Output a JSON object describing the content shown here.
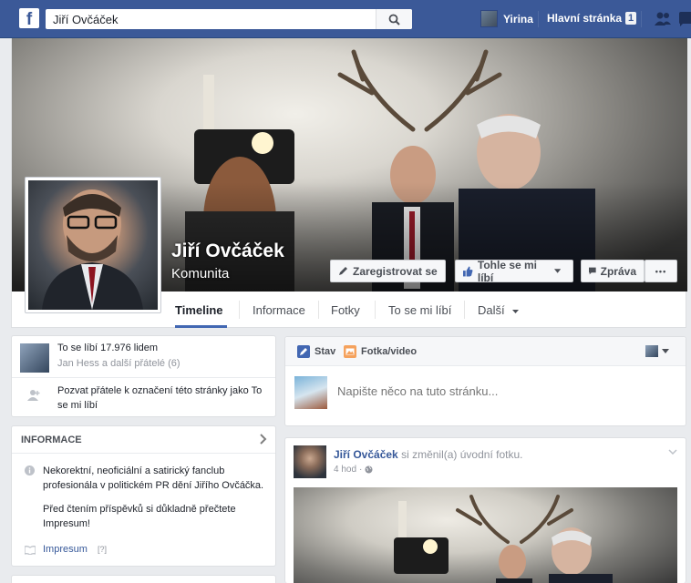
{
  "topbar": {
    "search_value": "Jiří Ovčáček",
    "user_name": "Yirina",
    "home_label": "Hlavní stránka",
    "home_count": "1",
    "brand_color": "#3b5998"
  },
  "page": {
    "name": "Jiří Ovčáček",
    "category": "Komunita",
    "buttons": {
      "register": "Zaregistrovat se",
      "like": "Tohle se mi líbí",
      "message": "Zpráva",
      "more": "•••"
    },
    "tabs": [
      "Timeline",
      "Informace",
      "Fotky",
      "To se mi líbí",
      "Další"
    ]
  },
  "likes_card": {
    "count_text": "To se líbí 17.976 lidem",
    "friends_text": "Jan Hess a další přátelé (6)",
    "invite_text": "Pozvat přátele k označení této stránky jako To se mi líbí"
  },
  "info_card": {
    "title": "INFORMACE",
    "description": "Nekorektní, neoficiální a satirický fanclub profesionála v politickém PR dění Jiřího Ovčáčka.",
    "note": "Před čtením příspěvků si důkladně přečtete Impresum!",
    "link_label": "Impresum",
    "link_hint": "[?]"
  },
  "composer": {
    "tab_status": "Stav",
    "tab_photo": "Fotka/video",
    "placeholder": "Napište něco na tuto stránku..."
  },
  "post": {
    "author": "Jiří Ovčáček",
    "action": "si změnil(a) úvodní fotku.",
    "time": "4 hod",
    "separator": "·"
  }
}
